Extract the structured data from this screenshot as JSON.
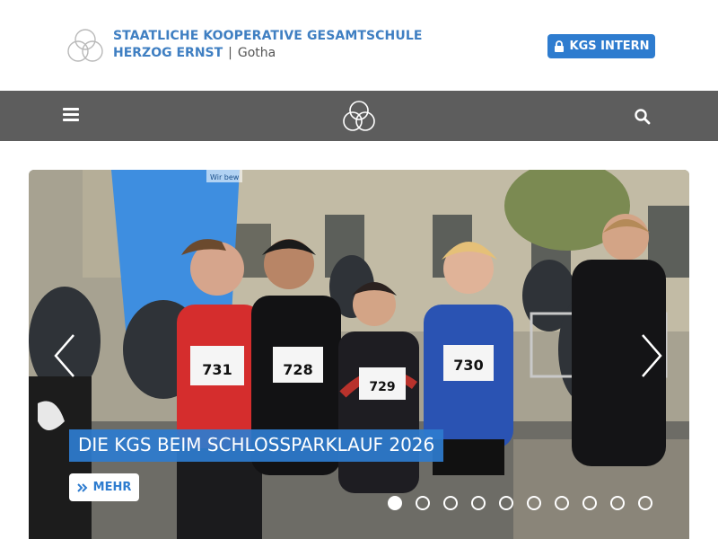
{
  "header": {
    "school_line1": "STAATLICHE KOOPERATIVE GESAMTSCHULE",
    "school_name": "HERZOG ERNST",
    "separator": "|",
    "city": "Gotha",
    "intern_label": "KGS INTERN",
    "logo_icon": "three-rings-logo",
    "lock_icon": "lock-icon"
  },
  "navbar": {
    "menu_icon": "hamburger-menu-icon",
    "logo_icon": "three-rings-logo",
    "search_icon": "search-icon"
  },
  "slider": {
    "caption": "DIE KGS BEIM SCHLOSSPARKLAUF 2026",
    "more_label": "MEHR",
    "slide_count": 10,
    "active_slide": 1,
    "bib_numbers": [
      "731",
      "728",
      "729",
      "730"
    ],
    "banner_text": "Wir bew"
  },
  "colors": {
    "brand_blue": "#2e7ccf",
    "navbar_gray": "#5d5d5d"
  }
}
